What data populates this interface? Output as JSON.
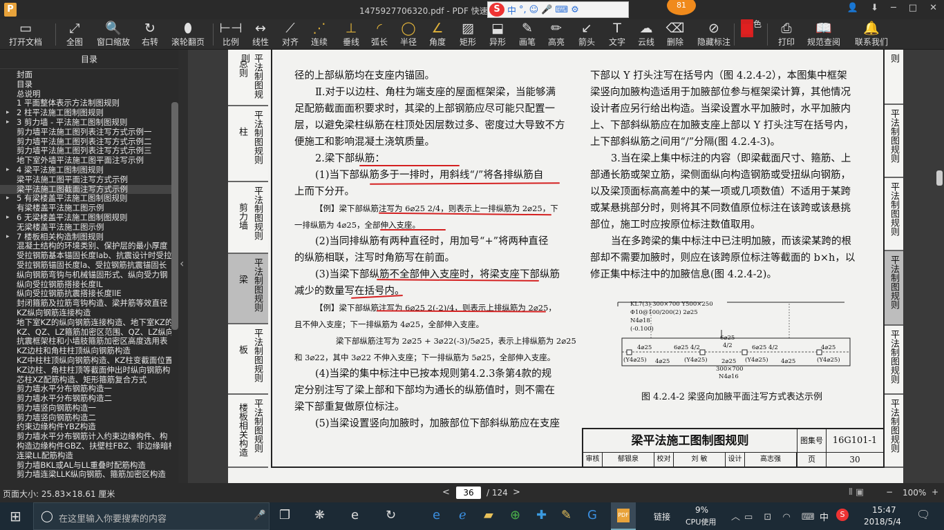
{
  "window": {
    "title": "1475927706320.pdf - PDF 快速看图",
    "logo": "P",
    "min": "─",
    "max": "□",
    "close": "✕",
    "user": "👤",
    "menu": "⬇"
  },
  "ime": {
    "logo": "S",
    "lang": "中",
    "punct": "°,",
    "emoji": "☺",
    "mic": "🎤",
    "kbd": "⌨",
    "tools": "⚙"
  },
  "badge": "81",
  "toolbar": [
    {
      "label": "打开文档",
      "icon": "▭",
      "name": "open-document-button"
    },
    {
      "label": "全图",
      "icon": "⤢",
      "name": "fit-all-button"
    },
    {
      "label": "窗口缩放",
      "icon": "🔍",
      "name": "window-zoom-button"
    },
    {
      "label": "右转",
      "icon": "↻",
      "name": "rotate-right-button"
    },
    {
      "label": "滚轮翻页",
      "icon": "⬮",
      "name": "wheel-page-button"
    },
    {
      "label": "比例",
      "icon": "⊢⊣",
      "name": "scale-button"
    },
    {
      "label": "线性",
      "icon": "↔",
      "name": "linear-measure-button"
    },
    {
      "label": "对齐",
      "icon": "⟋",
      "name": "aligned-measure-button"
    },
    {
      "label": "连续",
      "icon": "⋰",
      "name": "continuous-measure-button"
    },
    {
      "label": "垂线",
      "icon": "⊥",
      "name": "perpendicular-button"
    },
    {
      "label": "弧长",
      "icon": "◜",
      "name": "arc-length-button"
    },
    {
      "label": "半径",
      "icon": "◯",
      "name": "radius-button"
    },
    {
      "label": "角度",
      "icon": "∠",
      "name": "angle-button"
    },
    {
      "label": "矩形",
      "icon": "▨",
      "name": "rectangle-button"
    },
    {
      "label": "异形",
      "icon": "⬓",
      "name": "irregular-shape-button"
    },
    {
      "label": "画笔",
      "icon": "✎",
      "name": "pen-button"
    },
    {
      "label": "高亮",
      "icon": "✏",
      "name": "highlight-button"
    },
    {
      "label": "箭头",
      "icon": "↙",
      "name": "arrow-button"
    },
    {
      "label": "文字",
      "icon": "T",
      "name": "text-button"
    },
    {
      "label": "云线",
      "icon": "☁",
      "name": "cloud-line-button"
    },
    {
      "label": "删除",
      "icon": "⌫",
      "name": "delete-button"
    },
    {
      "label": "隐藏标注",
      "icon": "⊘",
      "name": "hide-markup-button"
    },
    {
      "label": "颜色",
      "icon": "■",
      "name": "color-button"
    },
    {
      "label": "打印",
      "icon": "⎙",
      "name": "print-button"
    },
    {
      "label": "规范查阅",
      "icon": "📖",
      "name": "standards-lookup-button"
    },
    {
      "label": "联系我们",
      "icon": "🔔",
      "name": "contact-us-button"
    }
  ],
  "sidebar": {
    "header": "目录",
    "collapse": "‹",
    "items": [
      {
        "t": "封面",
        "e": ""
      },
      {
        "t": "目录",
        "e": ""
      },
      {
        "t": "总说明",
        "e": ""
      },
      {
        "t": "1 平面整体表示方法制图规则",
        "e": ""
      },
      {
        "t": "2 柱平法施工图制图规则",
        "e": "▸"
      },
      {
        "t": "3 剪力墙 - 平法施工图制图规则",
        "e": "▸"
      },
      {
        "t": "剪力墙平法施工图列表注写方式示例一",
        "e": ""
      },
      {
        "t": "剪力墙平法施工图列表注写方式示例二",
        "e": ""
      },
      {
        "t": "剪力墙平法施工图列表注写方式示例三",
        "e": ""
      },
      {
        "t": "地下室外墙平法施工图平面注写示例",
        "e": ""
      },
      {
        "t": "4 梁平法施工图制图规则",
        "e": "▸"
      },
      {
        "t": "梁平法施工图平面注写方式示例",
        "e": ""
      },
      {
        "t": "梁平法施工图截面注写方式示例",
        "e": ""
      },
      {
        "t": "5 有梁楼盖平法施工图制图规则",
        "e": "▸"
      },
      {
        "t": "有梁楼盖平法施工图示例",
        "e": ""
      },
      {
        "t": "6 无梁楼盖平法施工图制图规则",
        "e": "▸"
      },
      {
        "t": "无梁楼盖平法施工图示例",
        "e": ""
      },
      {
        "t": "7 楼板相关构造制图规则",
        "e": "▸"
      },
      {
        "t": "混凝土结构的环境类别、保护层的最小厚度",
        "e": ""
      },
      {
        "t": "受拉钢筋基本锚固长度lab、抗震设计时受拉",
        "e": ""
      },
      {
        "t": "受拉钢筋锚固长度la、受拉钢筋抗震锚固长",
        "e": ""
      },
      {
        "t": "纵向钢筋弯钩与机械锚固形式、纵向受力钢",
        "e": ""
      },
      {
        "t": "纵向受拉钢筋搭接长度lL",
        "e": ""
      },
      {
        "t": "纵向受拉钢筋抗震搭接长度llE",
        "e": ""
      },
      {
        "t": "封闭箍筋及拉筋弯钩构造、梁并筋等效直径",
        "e": ""
      },
      {
        "t": "KZ纵向钢筋连接构造",
        "e": ""
      },
      {
        "t": "地下室KZ的纵向钢筋连接构造、地下室KZ的",
        "e": ""
      },
      {
        "t": "KZ、QZ、LZ箍筋加密区范围、QZ、LZ纵向钢筋",
        "e": ""
      },
      {
        "t": "抗震框架柱和小墙肢箍筋加密区高度选用表",
        "e": ""
      },
      {
        "t": "KZ边柱和角柱柱顶纵向钢筋构造",
        "e": ""
      },
      {
        "t": "KZ中柱柱顶纵向钢筋构造、KZ柱变截面位置",
        "e": ""
      },
      {
        "t": "KZ边柱、角柱柱顶等截面伸出时纵向钢筋构",
        "e": ""
      },
      {
        "t": "芯柱XZ配筋构造、矩形箍筋复合方式",
        "e": ""
      },
      {
        "t": "剪力墙水平分布钢筋构造一",
        "e": ""
      },
      {
        "t": "剪力墙水平分布钢筋构造二",
        "e": ""
      },
      {
        "t": "剪力墙竖向钢筋构造一",
        "e": ""
      },
      {
        "t": "剪力墙竖向钢筋构造二",
        "e": ""
      },
      {
        "t": "约束边缘构件YBZ构造",
        "e": ""
      },
      {
        "t": "剪力墙水平分布钢筋计入约束边缘构件、构",
        "e": ""
      },
      {
        "t": "构造边缘构件GBZ、扶壁柱FBZ、非边缘暗柱",
        "e": ""
      },
      {
        "t": "连梁LL配筋构造",
        "e": ""
      },
      {
        "t": "剪力墙BKL或AL与LL重叠时配筋构造",
        "e": ""
      },
      {
        "t": "剪力墙连梁LLK纵向钢筋、箍筋加密区构造",
        "e": ""
      }
    ]
  },
  "page": {
    "left_tabs": [
      "总则",
      "柱",
      "剪力墙",
      "梁",
      "板",
      "楼板相关构造"
    ],
    "left_tab_prefix": "平法制图规则",
    "right_tabs": [
      "平法制图规则",
      "平法制图规则",
      "平法制图规则",
      "平法制图规则",
      "平法制图规则",
      "平法制图规则"
    ],
    "col1": [
      "径的上部纵筋均在支座内锚固。",
      "Ⅱ.对于以边柱、角柱为端支座的屋面框架梁，当能够满",
      "足配筋截面面积要求时，其梁的上部钢筋应尽可能只配置一",
      "层，以避免梁柱纵筋在柱顶处因层数过多、密度过大导致不方",
      "便施工和影响混凝土浇筑质量。",
      "2.梁下部纵筋：",
      "(1)当下部纵筋多于一排时，用斜线“/”将各排纵筋自",
      "上而下分开。",
      "【例】梁下部纵筋注写为 6⌀25 2/4，则表示上一排纵筋为 2⌀25，下",
      "一排纵筋为 4⌀25，全部伸入支座。",
      "(2)当同排纵筋有两种直径时，用加号“+”将两种直径",
      "的纵筋相联，注写时角筋写在前面。",
      "(3)当梁下部纵筋不全部伸入支座时，将梁支座下部纵筋",
      "减少的数量写在括号内。",
      "【例】梁下部纵筋注写为 6⌀25 2(-2)/4，则表示上排纵筋为 2⌀25，",
      "且不伸入支座；下一排纵筋为 4⌀25，全部伸入支座。",
      "梁下部纵筋注写为 2⌀25 + 3⌀22(-3)/5⌀25，表示上排纵筋为 2⌀25",
      "和 3⌀22，其中 3⌀22 不伸入支座；下一排纵筋为 5⌀25，全部伸入支座。",
      "(4)当梁的集中标注中已按本规则第4.2.3条第4款的规",
      "定分别注写了梁上部和下部均为通长的纵筋值时，则不需在",
      "梁下部重复做原位标注。",
      "(5)当梁设置竖向加腋时，加腋部位下部斜纵筋应在支座"
    ],
    "col2": [
      "下部以 Y 打头注写在括号内（图 4.2.4-2），本图集中框架",
      "梁竖向加腋构造适用于加腋部位参与框架梁计算，其他情况",
      "设计者应另行给出构造。当梁设置水平加腋时，水平加腋内",
      "上、下部斜纵筋应在加腋支座上部以 Y 打头注写在括号内，",
      "上下部斜纵筋之间用“/”分隔(图 4.2.4-3)。",
      "3.当在梁上集中标注的内容（即梁截面尺寸、箍筋、上",
      "部通长筋或架立筋，梁侧面纵向构造钢筋或受扭纵向钢筋，",
      "以及梁顶面标高高差中的某一项或几项数值）不适用于某跨",
      "或某悬挑部分时，则将其不同数值原位标注在该跨或该悬挑",
      "部位，施工时应按原位标注数值取用。",
      "当在多跨梁的集中标注中已注明加腋，而该梁某跨的根",
      "部却不需要加腋时，则应在该跨原位标注等截面的 b×h，以",
      "修正集中标注中的加腋信息(图 4.2.4-2)。"
    ],
    "figure": {
      "caption": "图 4.2.4-2  梁竖向加腋平面注写方式表达示例",
      "l1": "KL7(3)  300×700 Y500×250",
      "l2": "Φ10@100/200(2) 2⌀25",
      "l3": "N4⌀18",
      "l4": "(-0.100)",
      "a": "4⌀25",
      "b": "6⌀25 4/2",
      "c": "6⌀25",
      "c2": "4/2",
      "d": "6⌀25 4/2",
      "e": "4⌀25",
      "f": "(Y4⌀25)",
      "g": "4⌀25",
      "h": "(Y4⌀25)",
      "i": "2⌀25",
      "j": "(Y4⌀25)",
      "k": "4⌀25",
      "m": "(Y4⌀25)",
      "n": "300×700",
      "o": "N4⌀16"
    },
    "titleblock": {
      "title": "梁平法施工图制图规则",
      "atlas_label": "图集号",
      "atlas_no": "16G101-1",
      "page_label": "页",
      "page_no": "30",
      "row": [
        "审核",
        "郁银泉",
        "校对",
        "刘  敏",
        "设计",
        "高志强"
      ]
    }
  },
  "status": {
    "page_size": "页面大小: 25.83×18.61 厘米",
    "prev": "<",
    "page": "36",
    "total": "/ 124",
    "next": ">",
    "zoom": "100%",
    "zoom_minus": "−",
    "zoom_plus": "+"
  },
  "taskbar": {
    "search_placeholder": "在这里输入你要搜索的内容",
    "link": "链接",
    "cpu_pct": "9%",
    "cpu_label": "CPU使用",
    "ime": "中",
    "time": "15:47",
    "date": "2018/5/4"
  }
}
